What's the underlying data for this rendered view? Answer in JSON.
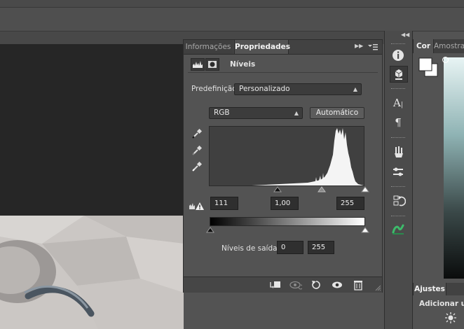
{
  "panel": {
    "tabs": [
      {
        "label": "Informações",
        "active": false
      },
      {
        "label": "Propriedades",
        "active": true
      }
    ],
    "title": "Níveis",
    "preset_label": "Predefinição:",
    "preset_value": "Personalizado",
    "channel_value": "RGB",
    "auto_button": "Automático",
    "input_black": "111",
    "input_mid": "1,00",
    "input_white": "255",
    "output_label": "Níveis de saída:",
    "output_black": "0",
    "output_white": "255"
  },
  "color_panel": {
    "tabs": [
      {
        "label": "Cor",
        "active": true
      },
      {
        "label": "Amostras",
        "active": false
      }
    ]
  },
  "adjustments_panel": {
    "tab": "Ajustes",
    "heading": "Adicionar um ajuste"
  },
  "icons": {
    "dock": [
      "info-icon",
      "properties-icon",
      "character-icon",
      "paragraph-icon",
      "brushes-icon",
      "brush-settings-icon",
      "history-icon",
      "layer-comps-icon",
      "plugin-icon"
    ],
    "footer": [
      "clip-to-layer-icon",
      "view-previous-state-icon",
      "reset-icon",
      "visibility-eye-icon",
      "delete-trash-icon"
    ]
  },
  "colors": {
    "panel_bg": "#535353",
    "canvas_bg": "#262626",
    "plugin_green": "#3dbb6b"
  }
}
